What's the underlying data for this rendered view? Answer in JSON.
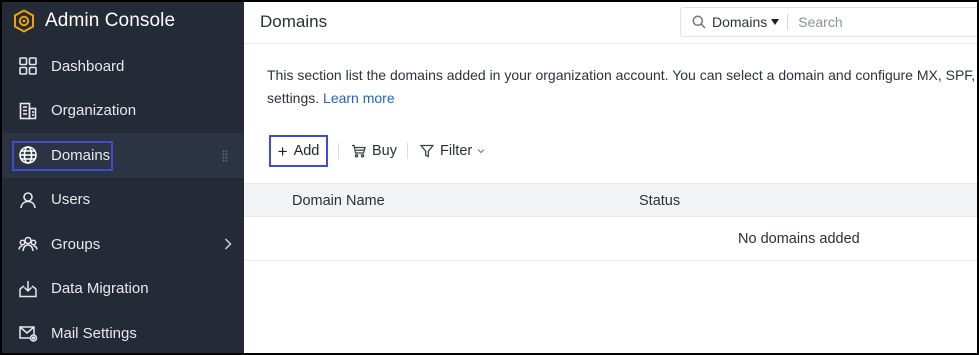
{
  "sidebar": {
    "brand": "Admin Console",
    "items": [
      {
        "label": "Dashboard",
        "icon": "dashboard-icon"
      },
      {
        "label": "Organization",
        "icon": "building-icon"
      },
      {
        "label": "Domains",
        "icon": "globe-icon",
        "active": true
      },
      {
        "label": "Users",
        "icon": "user-icon"
      },
      {
        "label": "Groups",
        "icon": "groups-icon"
      },
      {
        "label": "Data Migration",
        "icon": "migration-icon"
      },
      {
        "label": "Mail Settings",
        "icon": "mail-settings-icon"
      }
    ]
  },
  "header": {
    "title": "Domains",
    "search": {
      "scope": "Domains",
      "placeholder": "Search"
    }
  },
  "main": {
    "description_line1": "This section list the domains added in your organization account. You can select a domain and configure MX, SPF,",
    "description_line2_text": "settings.",
    "learn_more": "Learn more",
    "toolbar": {
      "add": "Add",
      "buy": "Buy",
      "filter": "Filter"
    },
    "table": {
      "columns": [
        "Domain Name",
        "Status"
      ],
      "empty_message": "No domains added"
    }
  },
  "colors": {
    "sidebar_bg": "#242a36",
    "highlight": "#3d4fcf",
    "link": "#2463c6",
    "brand_icon": "#f0a30a"
  }
}
